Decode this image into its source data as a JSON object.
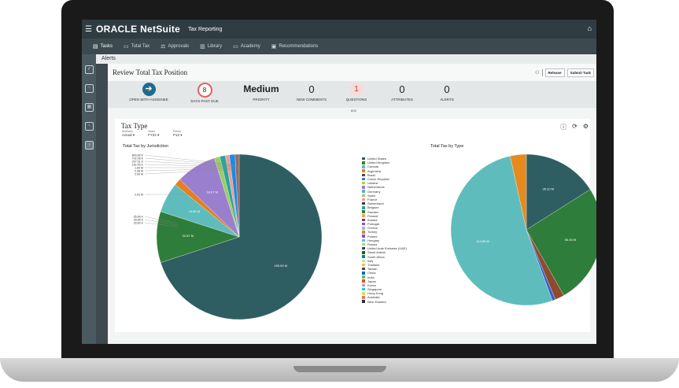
{
  "topbar": {
    "logo": "ORACLE NetSuite",
    "app_name": "Tax Reporting"
  },
  "tabs": [
    {
      "label": "Tasks",
      "icon": "tasks-icon"
    },
    {
      "label": "Total Tax",
      "icon": "chat-icon"
    },
    {
      "label": "Approvals",
      "icon": "approvals-icon"
    },
    {
      "label": "Library",
      "icon": "library-icon"
    },
    {
      "label": "Academy",
      "icon": "academy-icon"
    },
    {
      "label": "Recommendations",
      "icon": "recommendations-icon"
    }
  ],
  "alerts_label": "Alerts",
  "review": {
    "title": "Review Total Tax Position",
    "release_label": "Release",
    "submit_label": "Submit Task"
  },
  "metrics": {
    "open_with_assignee": "OPEN WITH ASSIGNEE",
    "days_past_due": {
      "value": "8",
      "label": "DAYS PAST DUE"
    },
    "priority": {
      "value": "Medium",
      "label": "PRIORITY"
    },
    "new_comments": {
      "value": "0",
      "label": "NEW COMMENTS"
    },
    "questions": {
      "value": "1",
      "label": "QUESTIONS"
    },
    "attributes": {
      "value": "0",
      "label": "ATTRIBUTES"
    },
    "alerts": {
      "value": "0",
      "label": "ALERTS"
    },
    "footnote": "828"
  },
  "tax_type": {
    "title": "Tax Type",
    "scenario": {
      "label": "Scenario",
      "value": "Actual"
    },
    "years": {
      "label": "Years",
      "value": "FY22"
    },
    "period": {
      "label": "Period",
      "value": "P12"
    }
  },
  "chart_data": [
    {
      "type": "pie",
      "title": "Total Tax by Jurisdiction",
      "slices": [
        {
          "label": "159.99 M",
          "value": 159.99,
          "color": "#2e5e62"
        },
        {
          "label": "22.87 M",
          "value": 22.87,
          "color": "#2f7d3a"
        },
        {
          "label": "13.56 M",
          "value": 13.56,
          "color": "#5fbcbc"
        },
        {
          "label": "3.03 M",
          "value": 3.03,
          "color": "#e67e22"
        },
        {
          "label": "18.07 M",
          "value": 18.07,
          "color": "#9b7fcf"
        },
        {
          "label": "2.50 M",
          "value": 2.5,
          "color": "#9ccc65"
        },
        {
          "label": "2.48 M",
          "value": 2.48,
          "color": "#26a69a"
        },
        {
          "label": "1.84 M",
          "value": 1.84,
          "color": "#ef9a9a"
        },
        {
          "label": "2.48 M",
          "value": 2.48,
          "color": "#1e88e5"
        },
        {
          "label": "1.84 M",
          "value": 1.84,
          "color": "#8d6e63"
        }
      ],
      "outer_labels": [
        "809.66 K",
        "702.06 K",
        "257.51 K",
        "182.45 K",
        "1.84 M",
        "2.48 M",
        "2.50 M",
        "3.03 M",
        "35.66 K",
        "28.65 K",
        "33.60 K"
      ],
      "legend": [
        {
          "name": "United States",
          "color": "#2e5e62"
        },
        {
          "name": "United Kingdom",
          "color": "#2f7d3a"
        },
        {
          "name": "Canada",
          "color": "#5fbcbc"
        },
        {
          "name": "Argentina",
          "color": "#e67e22"
        },
        {
          "name": "Brazil",
          "color": "#5d4037"
        },
        {
          "name": "Czech Republic",
          "color": "#3a7bd5"
        },
        {
          "name": "Ukraine",
          "color": "#c0ca33"
        },
        {
          "name": "Netherlands",
          "color": "#9b7fcf"
        },
        {
          "name": "Germany",
          "color": "#4db6ac"
        },
        {
          "name": "Spain",
          "color": "#9ccc65"
        },
        {
          "name": "France",
          "color": "#ef9a9a"
        },
        {
          "name": "Switzerland",
          "color": "#4e342e"
        },
        {
          "name": "Belgium",
          "color": "#26a69a"
        },
        {
          "name": "Sweden",
          "color": "#2e7d32"
        },
        {
          "name": "Finland",
          "color": "#f4a261"
        },
        {
          "name": "Austria",
          "color": "#6d4c41"
        },
        {
          "name": "Portugal",
          "color": "#ab47bc"
        },
        {
          "name": "Greece",
          "color": "#80cbc4"
        },
        {
          "name": "Turkey",
          "color": "#ff7043"
        },
        {
          "name": "Poland",
          "color": "#7e57c2"
        },
        {
          "name": "Hungary",
          "color": "#4fc3f7"
        },
        {
          "name": "Russia",
          "color": "#aed581"
        },
        {
          "name": "United Arab Emirates (UAE)",
          "color": "#37474f"
        },
        {
          "name": "Saudi Arabia",
          "color": "#1b5e20"
        },
        {
          "name": "South Africa",
          "color": "#00897b"
        },
        {
          "name": "Italy",
          "color": "#c5e1a5"
        },
        {
          "name": "Thailand",
          "color": "#ffb74d"
        },
        {
          "name": "Taiwan",
          "color": "#5d4037"
        },
        {
          "name": "China",
          "color": "#1565c0"
        },
        {
          "name": "India",
          "color": "#66bb6a"
        },
        {
          "name": "Japan",
          "color": "#e65100"
        },
        {
          "name": "Korea",
          "color": "#b39ddb"
        },
        {
          "name": "Singapore",
          "color": "#26c6da"
        },
        {
          "name": "Hong Kong",
          "color": "#d4e157"
        },
        {
          "name": "Australia",
          "color": "#e57373"
        },
        {
          "name": "New Zealand",
          "color": "#263238"
        }
      ]
    },
    {
      "type": "pie",
      "title": "Total Tax by Type",
      "slices": [
        {
          "label": "35.20 M",
          "value": 35.2,
          "color": "#2e5e62"
        },
        {
          "label": "56.46 M",
          "value": 56.46,
          "color": "#2f7d3a"
        },
        {
          "label": "4.37 M",
          "value": 4.37,
          "color": "#8d4a2f"
        },
        {
          "label": "1.52 M",
          "value": 1.52,
          "color": "#3a5fcf"
        },
        {
          "label": "114.55 M",
          "value": 114.55,
          "color": "#5fbcbc"
        },
        {
          "label": "7.57 M",
          "value": 7.57,
          "color": "#e68a1e"
        }
      ]
    }
  ]
}
